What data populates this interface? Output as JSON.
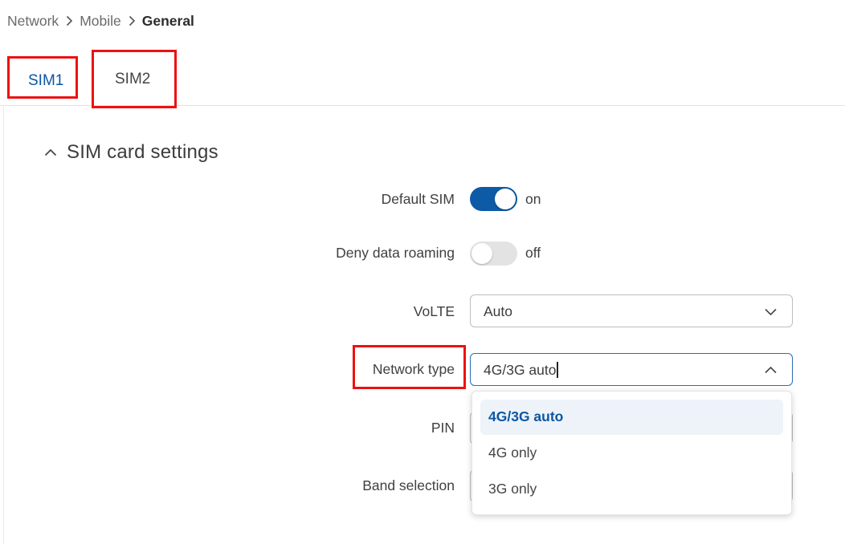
{
  "breadcrumb": {
    "items": [
      "Network",
      "Mobile",
      "General"
    ]
  },
  "tabs": [
    {
      "label": "SIM1"
    },
    {
      "label": "SIM2"
    }
  ],
  "section": {
    "title": "SIM card settings"
  },
  "fields": {
    "default_sim": {
      "label": "Default SIM",
      "state": "on"
    },
    "deny_roaming": {
      "label": "Deny data roaming",
      "state": "off"
    },
    "volte": {
      "label": "VoLTE",
      "value": "Auto"
    },
    "network_type": {
      "label": "Network type",
      "value": "4G/3G auto"
    },
    "pin": {
      "label": "PIN"
    },
    "band_selection": {
      "label": "Band selection"
    }
  },
  "dropdown": {
    "options": [
      "4G/3G auto",
      "4G only",
      "3G only"
    ]
  },
  "colors": {
    "accent": "#0d5aa7",
    "highlight": "#ee1111"
  }
}
